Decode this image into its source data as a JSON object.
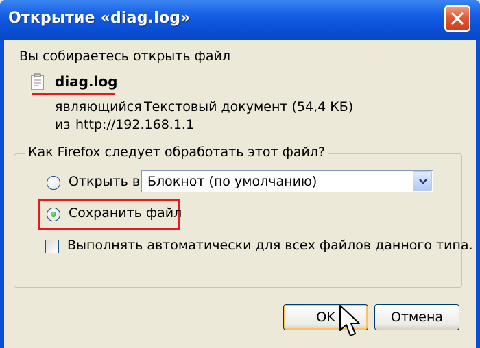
{
  "window": {
    "title": "Открытие «diag.log»"
  },
  "dialog": {
    "intro": "Вы собираетесь открыть файл",
    "file_name": "diag.log",
    "type_label": "являющийся",
    "type_value": "Текстовый документ (54,4 КБ)",
    "from_label": "из",
    "from_value": "http://192.168.1.1"
  },
  "action_group": {
    "title": "Как Firefox следует обработать этот файл?",
    "open_with_label": "Открыть в",
    "open_with_selected": "Блокнот (по умолчанию)",
    "save_file_label": "Сохранить файл",
    "selected_option": "save_file",
    "auto_checkbox_label": "Выполнять автоматически для всех файлов данного типа.",
    "auto_checked": false
  },
  "buttons": {
    "ok_label": "OK",
    "cancel_label": "Отмена"
  },
  "icons": {
    "close": "close-icon",
    "file": "text-file-icon",
    "combo": "chevron-down-icon",
    "cursor": "mouse-pointer-icon"
  },
  "colors": {
    "titlebar": "#0b50d6",
    "highlight": "#e8191c",
    "client": "#ece9d8"
  }
}
